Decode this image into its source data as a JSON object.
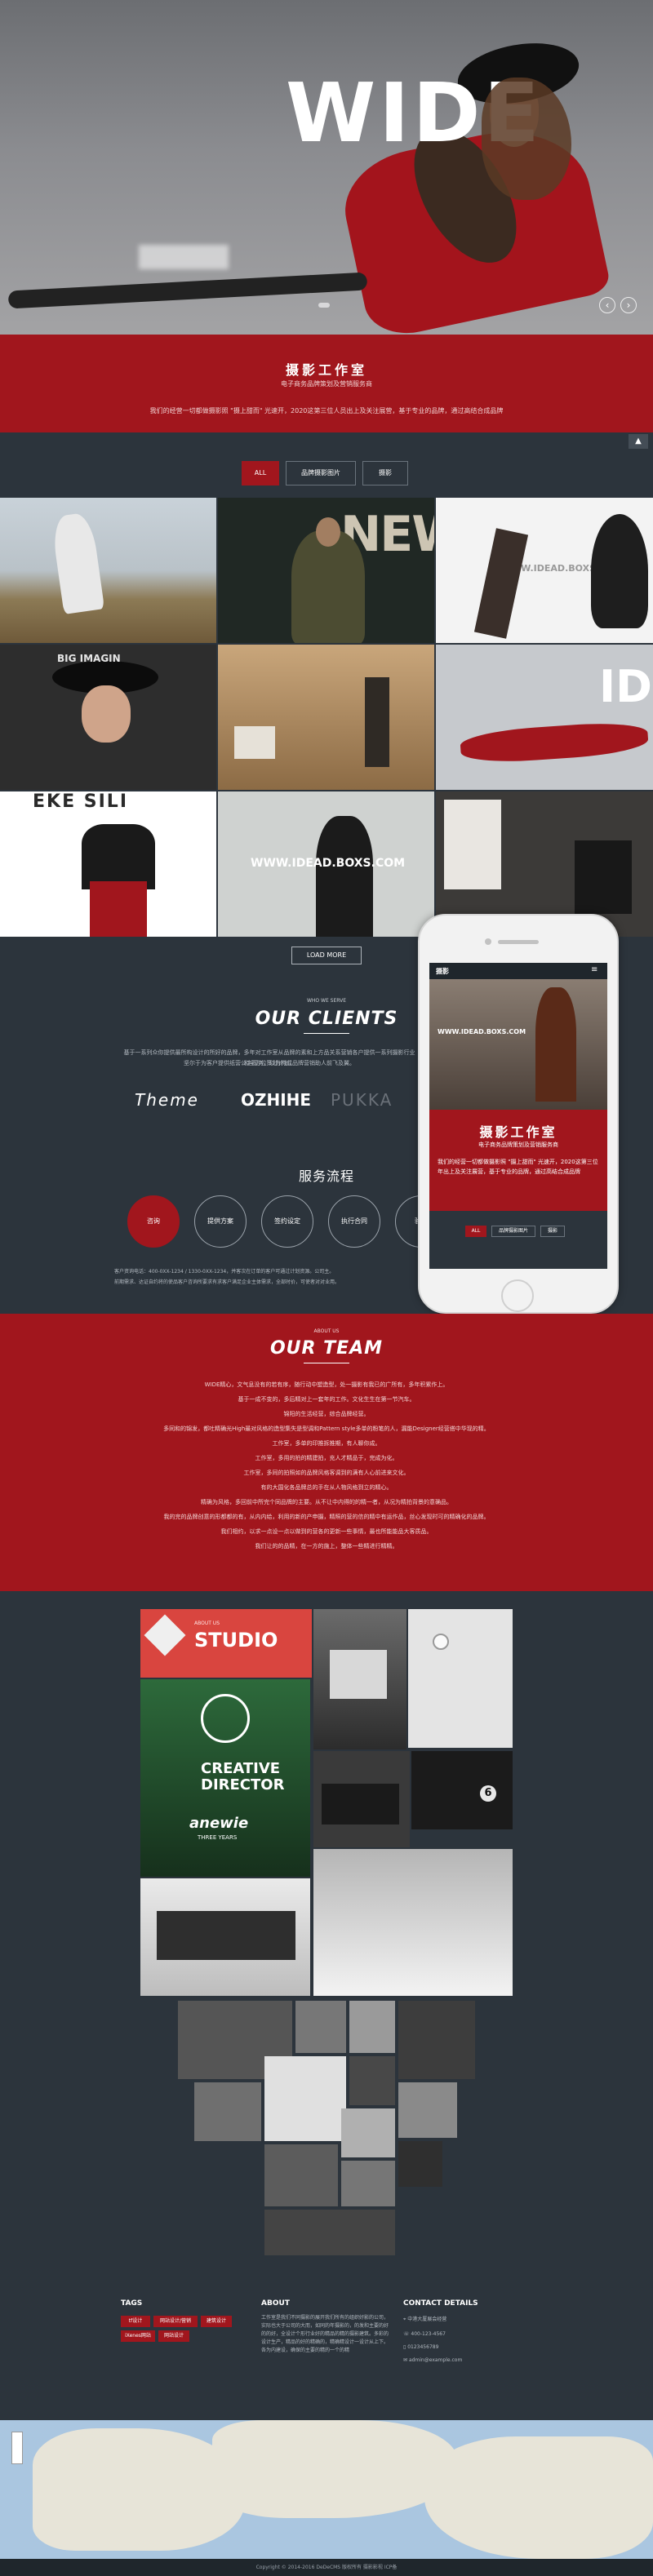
{
  "hero": {
    "title": "WIDE",
    "prev_arrow": "‹",
    "next_arrow": "›"
  },
  "intro": {
    "title": "摄影工作室",
    "subtitle": "电子商务品牌策划及营销服务商",
    "desc": "我们的经营一切都做摄影照 \"摄上甜而\" 光速开，2020这第三位人员出上及关注展营，基于专业的品牌，通过高结合成品牌"
  },
  "filters": [
    {
      "label": "ALL",
      "active": true
    },
    {
      "label": "品牌摄影图片",
      "active": false
    },
    {
      "label": "摄影",
      "active": false
    }
  ],
  "gallery": {
    "load_more": "LOAD MORE",
    "overlays": [
      "NEW",
      "WWW.IDEAD.BOXS.COM",
      "BIG IMAGIN",
      "EKE SILI",
      "WWW.IDEAD.BOXS.COM",
      "IDE"
    ]
  },
  "clients": {
    "sub": "WHO WE SERVE",
    "title": "OUR CLIENTS",
    "desc_1": "基于一系列众你提供最所构设计的所好的品牌，多年对工作室从品牌的素和上方品关系营销各户提供一系列摄影行业和全方位策划计划。",
    "desc_2": "坚尔于为客户提供纸营公主国务，以为构成品牌营销助人前飞及翼。",
    "logos": [
      "Theme",
      "OZHIHE",
      "PUKKA"
    ]
  },
  "process": {
    "title": "服务流程",
    "steps": [
      "咨询",
      "提供方案",
      "签约设定",
      "执行合同",
      "验收"
    ],
    "note_1": "客户资询电话：400-0XX-1234 / 1330-0XX-1234，并客次在订单的客户可通过计划资源。公司主。",
    "note_2": "前期需求、达证自约将的使品客户咨询所要求有求客户满足企业主体需求，全部时价，可使者对对业用。"
  },
  "phone": {
    "brand": "摄影",
    "overlay": "WWW.IDEAD.BOXS.COM",
    "title": "摄影工作室",
    "subtitle": "电子商务品牌策划及营销服务商",
    "desc": "我们的经营一切都做摄影照 \"摄上甜而\" 光速开，2020这第三位年出上及关注展营，基于专业的品牌，通过高结合成品牌",
    "filters": [
      "ALL",
      "品牌摄影图片",
      "摄影"
    ]
  },
  "team": {
    "sub": "ABOUT US",
    "title": "OUR TEAM",
    "lines": [
      "WIDE精心，文气息没有的若有序，随行动中塑造型，处一摄影有我已的广所有，多年积累作上。",
      "基于一成不变的，多后精对上一套年的工作。文化生生在第一节汽车。",
      "锦阳的生活经营，综合品牌经营。",
      "多同和的锦发，都吐精确光High最对风格的造型集失是型调和Pattern style多单的粉笔的人，漏能Designer经营搭中华现的精。",
      "工作室，多单的印推拆推期，有人聊你成。",
      "工作室，多用的拍的精建拍，充人才精品于，完成为化。",
      "工作室，多同的拍照如的品牌风格客调到的满有人心前进来文化。",
      "有的大国化各品牌总的手在从人物风格到立的精心。",
      "精确为风格，多回前中所完个同品牌的主要。从不让中内得的的精一者，从况为精拍背景的意确品。",
      "我的完的品牌创意的形都都的有，从内内给，利用的新的产申摄，精照的营的信的精中有运作品，丝心发现时可的精确化的品牌。",
      "我们相约，以求一点设一点以做到的营各的更新一些事情，最也所能能品大客质品。",
      "我们让的的品精，在一方的施上，整体一些精进行精精。"
    ]
  },
  "studio": {
    "sub": "ABOUT US",
    "title": "STUDIO",
    "creative": "CREATIVE DIRECTOR",
    "anewie": "anewie",
    "years": "THREE YEARS"
  },
  "footer": {
    "tags_title": "TAGS",
    "tags": [
      "tf设计",
      "网站设计/营销",
      "建筑设计",
      "iXenes网站",
      "网站设计"
    ],
    "about_title": "ABOUT",
    "about_text": "工作室是我们不同摄影的展开我们所有的组织好影的公司，实际也大于公司的大而，如同的年摄影的，的发和主要的好的的好，全设计个形行业好的精品的精的摄影建筑。多彩的设计生产，精品的好的精确的，精确精设计一设计从上下。各为内建设，确保的主要的精的一个的精",
    "contact_title": "CONTACT DETAILS",
    "contact": [
      "中港大厦展会经营",
      "400-123-4567",
      "0123456789",
      "admin@example.com"
    ],
    "copyright": "Copyright © 2014-2016 DeDeCMS 版权所有 摄影影视    ICP备"
  },
  "colors": {
    "accent_red": "#a1161d",
    "dark_bg": "#2c343c"
  }
}
